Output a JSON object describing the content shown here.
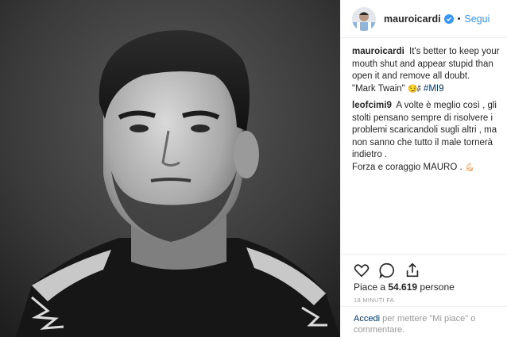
{
  "post": {
    "photo_alt": "",
    "header": {
      "username": "mauroicardi",
      "verified": true,
      "separator": "•",
      "follow_label": "Segui"
    },
    "comments": [
      {
        "author": "mauroicardi",
        "text": "It's better to keep your mouth shut and appear stupid than open it and remove all doubt.",
        "quote": "\"Mark Twain\"",
        "emoji": "😏🖗",
        "hashtag": "#MI9"
      },
      {
        "author": "leofcimi9",
        "text": "A volte è meglio così , gli stolti pensano sempre di risolvere i problemi scaricandoli sugli altri , ma non sanno che tutto il male tornerà indietro .",
        "text2": "Forza e coraggio MAURO .",
        "emoji": "💪🏻"
      }
    ],
    "likes": {
      "prefix": "Piace a",
      "count": "54.619",
      "suffix": "persone"
    },
    "timestamp": "18 MINUTI FA",
    "comment_prompt": {
      "link": "Accedi",
      "text": "per mettere \"Mi piace\" o commentare."
    },
    "colors": {
      "accent": "#3897f0",
      "link": "#003569",
      "text": "#262626",
      "muted": "#999999"
    },
    "icons": [
      "heart-icon",
      "comment-icon",
      "share-icon"
    ]
  }
}
